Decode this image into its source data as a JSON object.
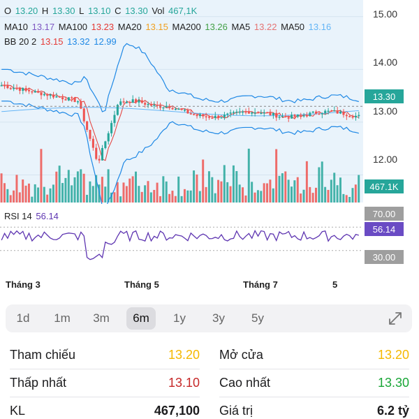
{
  "ohlc": {
    "o_label": "O",
    "o_value": "13.20",
    "h_label": "H",
    "h_value": "13.30",
    "l_label": "L",
    "l_value": "13.10",
    "c_label": "C",
    "c_value": "13.30",
    "vol_label": "Vol",
    "vol_value": "467,1K"
  },
  "ma_line": {
    "ma10_label": "MA10",
    "ma10_value": "13.17",
    "ma100_label": "MA100",
    "ma100_value": "13.23",
    "ma20_label": "MA20",
    "ma20_value": "13.15",
    "ma200_label": "MA200",
    "ma200_value": "13.26",
    "ma5_label": "MA5",
    "ma5_value": "13.22",
    "ma50_label": "MA50",
    "ma50_value": "13.16"
  },
  "bb_line": {
    "label": "BB 20 2",
    "mid": "13.15",
    "upper": "13.32",
    "lower": "12.99"
  },
  "price_axis": {
    "ticks": [
      "15.00",
      "14.00",
      "13.00",
      "12.00"
    ],
    "current_price": "13.30",
    "volume_badge": "467.1K"
  },
  "rsi": {
    "label": "RSI 14",
    "value": "56.14",
    "upper_level": "70.00",
    "lower_level": "30.00"
  },
  "months": [
    "Tháng 3",
    "Tháng 5",
    "Tháng 7",
    "5"
  ],
  "ranges": [
    "1d",
    "1m",
    "3m",
    "6m",
    "1y",
    "3y",
    "5y"
  ],
  "active_range": "6m",
  "stats": {
    "reference_label": "Tham chiếu",
    "reference_value": "13.20",
    "open_label": "Mở cửa",
    "open_value": "13.20",
    "low_label": "Thấp nhất",
    "low_value": "13.10",
    "high_label": "Cao nhất",
    "high_value": "13.30",
    "volume_label": "KL",
    "volume_value": "467,100",
    "turnover_label": "Giá trị",
    "turnover_value": "6.2 tỷ"
  },
  "colors": {
    "up": "#26a69a",
    "down": "#ef5350",
    "reference": "#f5b800",
    "high_green": "#18a636",
    "low_red": "#c62828",
    "ma10": "#7e57c2",
    "ma100": "#e53935",
    "ma20": "#f0a020",
    "ma200": "#43a047",
    "ma5": "#e57373",
    "ma50": "#64b5f6",
    "bb_mid": "#e53935",
    "bb_band": "#1e88e5",
    "rsi_line": "#5e35b1",
    "rsi_badge": "#6a4bc4",
    "level_badge": "#9e9e9e"
  },
  "chart_data": {
    "type": "candlestick",
    "ylim": [
      11.9,
      15.05
    ],
    "candle_count": 118,
    "price_levels": {
      "open": 13.2,
      "high": 13.3,
      "low": 13.1,
      "close": 13.3
    },
    "rsi_range": [
      0,
      100
    ],
    "rsi_levels": [
      70,
      30
    ],
    "rsi_last": 56.14
  }
}
